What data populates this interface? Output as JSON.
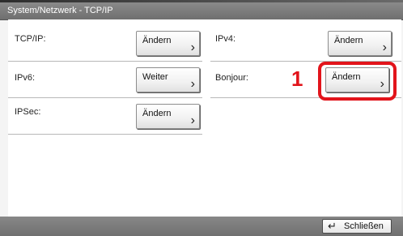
{
  "window": {
    "title": "System/Netzwerk - TCP/IP"
  },
  "settings": {
    "left": [
      {
        "label": "TCP/IP:",
        "button": "Ändern"
      },
      {
        "label": "IPv6:",
        "button": "Weiter"
      },
      {
        "label": "IPSec:",
        "button": "Ändern"
      }
    ],
    "right": [
      {
        "label": "IPv4:",
        "button": "Ändern"
      },
      {
        "label": "Bonjour:",
        "button": "Ändern"
      }
    ]
  },
  "annotation": {
    "callout_number": "1",
    "color": "#e2141b"
  },
  "footer": {
    "close_label": "Schließen",
    "close_icon": "enter-return-icon"
  },
  "icons": {
    "chevron": "chevron-right-icon"
  }
}
